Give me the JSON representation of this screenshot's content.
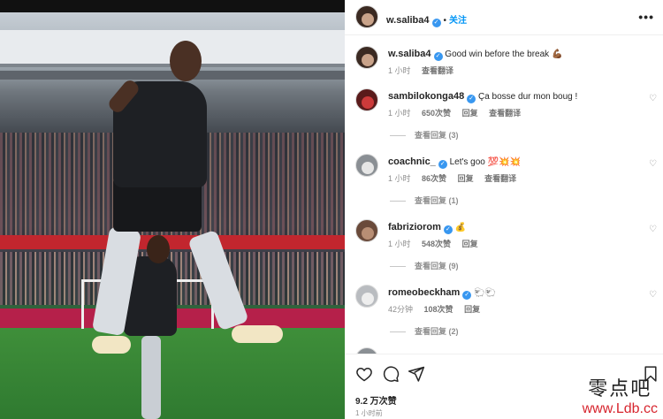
{
  "post": {
    "author": "w.saliba4",
    "follow_label": "关注",
    "dot": "•",
    "more_label": "•••"
  },
  "caption": {
    "username": "w.saliba4",
    "text": "Good win before the break",
    "emoji": "💪🏾",
    "time": "1 小时",
    "translate": "查看翻译"
  },
  "comments": [
    {
      "username": "sambilokonga48",
      "text": "Ça bosse dur mon boug !",
      "emoji": "",
      "time": "1 小时",
      "likes": "650次赞",
      "reply": "回复",
      "translate": "查看翻译",
      "replies": "查看回复 (3)"
    },
    {
      "username": "coachnic_",
      "text": "Let's goo",
      "emoji": "💯💥💥",
      "time": "1 小时",
      "likes": "86次赞",
      "reply": "回复",
      "translate": "查看翻译",
      "replies": "查看回复 (1)"
    },
    {
      "username": "fabriziorom",
      "text": "",
      "emoji": "💰",
      "time": "1 小时",
      "likes": "548次赞",
      "reply": "回复",
      "translate": "",
      "replies": "查看回复 (9)"
    },
    {
      "username": "romeobeckham",
      "text": "",
      "emoji": "🐑🐑",
      "time": "42分钟",
      "likes": "108次赞",
      "reply": "回复",
      "translate": "",
      "replies": "查看回复 (2)"
    }
  ],
  "footer": {
    "likes": "9.2 万次赞",
    "time": "1 小时前"
  },
  "watermark": {
    "cn": "零点吧",
    "url": "www.Ldb.cc"
  },
  "icons": [
    "heart-icon",
    "comment-icon",
    "share-icon",
    "bookmark-icon",
    "verified-icon",
    "more-icon"
  ],
  "colors": {
    "accent": "#0095f6",
    "verified": "#3897f0",
    "muted": "#8e8e8e"
  }
}
